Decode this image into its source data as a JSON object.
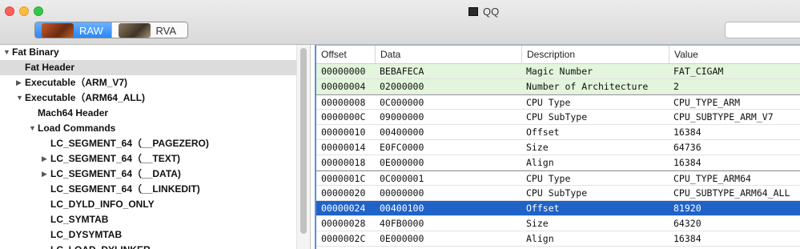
{
  "window": {
    "title": "QQ"
  },
  "toolbar": {
    "segments": [
      {
        "label": "RAW",
        "thumbnail": "lobster-thumbnail",
        "selected": true
      },
      {
        "label": "RVA",
        "thumbnail": "crab-thumbnail",
        "selected": false
      }
    ],
    "search": {
      "value": "",
      "placeholder": ""
    }
  },
  "tree": [
    {
      "label": "Fat Binary",
      "depth": 0,
      "expander": "expanded"
    },
    {
      "label": "Fat Header",
      "depth": 1,
      "expander": "none",
      "selected": true
    },
    {
      "label": "Executable（ARM_V7)",
      "depth": 1,
      "expander": "collapsed"
    },
    {
      "label": "Executable（ARM64_ALL)",
      "depth": 1,
      "expander": "expanded"
    },
    {
      "label": "Mach64 Header",
      "depth": 2,
      "expander": "none"
    },
    {
      "label": "Load Commands",
      "depth": 2,
      "expander": "expanded"
    },
    {
      "label": "LC_SEGMENT_64（__PAGEZERO)",
      "depth": 3,
      "expander": "none"
    },
    {
      "label": "LC_SEGMENT_64（__TEXT)",
      "depth": 3,
      "expander": "collapsed"
    },
    {
      "label": "LC_SEGMENT_64（__DATA)",
      "depth": 3,
      "expander": "collapsed"
    },
    {
      "label": "LC_SEGMENT_64（__LINKEDIT)",
      "depth": 3,
      "expander": "none"
    },
    {
      "label": "LC_DYLD_INFO_ONLY",
      "depth": 3,
      "expander": "none"
    },
    {
      "label": "LC_SYMTAB",
      "depth": 3,
      "expander": "none"
    },
    {
      "label": "LC_DYSYMTAB",
      "depth": 3,
      "expander": "none"
    },
    {
      "label": "LC_LOAD_DYLINKER",
      "depth": 3,
      "expander": "none"
    }
  ],
  "table": {
    "columns": [
      "Offset",
      "Data",
      "Description",
      "Value"
    ],
    "rows": [
      {
        "offset": "00000000",
        "data": "BEBAFECA",
        "description": "Magic Number",
        "value": "FAT_CIGAM",
        "style": "green"
      },
      {
        "offset": "00000004",
        "data": "02000000",
        "description": "Number of Architecture",
        "value": "2",
        "style": "green"
      },
      {
        "offset": "00000008",
        "data": "0C000000",
        "description": "CPU Type",
        "value": "CPU_TYPE_ARM",
        "style": "group-start"
      },
      {
        "offset": "0000000C",
        "data": "09000000",
        "description": "CPU SubType",
        "value": "CPU_SUBTYPE_ARM_V7",
        "style": ""
      },
      {
        "offset": "00000010",
        "data": "00400000",
        "description": "Offset",
        "value": "16384",
        "style": ""
      },
      {
        "offset": "00000014",
        "data": "E0FC0000",
        "description": "Size",
        "value": "64736",
        "style": ""
      },
      {
        "offset": "00000018",
        "data": "0E000000",
        "description": "Align",
        "value": "16384",
        "style": ""
      },
      {
        "offset": "0000001C",
        "data": "0C000001",
        "description": "CPU Type",
        "value": "CPU_TYPE_ARM64",
        "style": "group-start"
      },
      {
        "offset": "00000020",
        "data": "00000000",
        "description": "CPU SubType",
        "value": "CPU_SUBTYPE_ARM64_ALL",
        "style": ""
      },
      {
        "offset": "00000024",
        "data": "00400100",
        "description": "Offset",
        "value": "81920",
        "style": "selected"
      },
      {
        "offset": "00000028",
        "data": "40FB0000",
        "description": "Size",
        "value": "64320",
        "style": ""
      },
      {
        "offset": "0000002C",
        "data": "0E000000",
        "description": "Align",
        "value": "16384",
        "style": ""
      }
    ]
  },
  "colors": {
    "accent": "#1f63c8",
    "green_row": "#e3f5dc",
    "selected_tree_row": "#dcdcdc"
  }
}
